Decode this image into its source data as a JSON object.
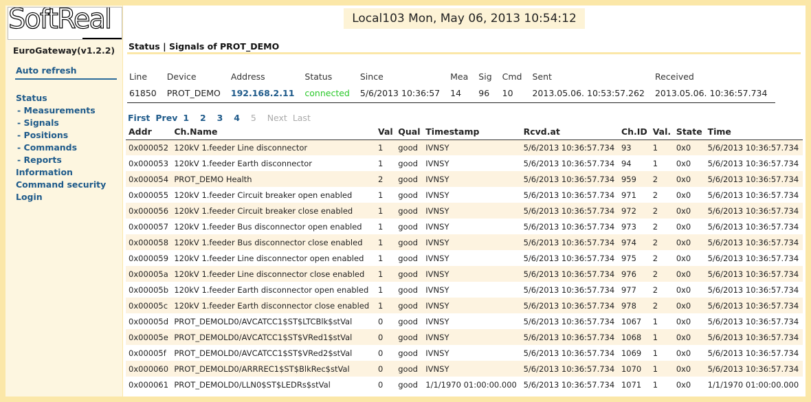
{
  "logo": {
    "text": "SoftReal"
  },
  "app_version": "EuroGateway(v1.2.2)",
  "sidebar": {
    "auto_refresh": "Auto refresh",
    "status": "Status",
    "measurements": "- Measurements",
    "signals": "- Signals",
    "positions": "- Positions",
    "commands": "- Commands",
    "reports": "- Reports",
    "information": "Information",
    "command_security": "Command security",
    "login": "Login"
  },
  "header": {
    "clock": "Local103 Mon, May 06, 2013 10:54:12"
  },
  "page_heading": "Status | Signals of PROT_DEMO",
  "line_table": {
    "headers": [
      "Line",
      "Device",
      "Address",
      "Status",
      "Since",
      "Mea",
      "Sig",
      "Cmd",
      "Sent",
      "Received"
    ],
    "row": {
      "line": "61850",
      "device": "PROT_DEMO",
      "address": "192.168.2.11",
      "status": "connected",
      "since": "5/6/2013 10:36:57",
      "mea": "14",
      "sig": "96",
      "cmd": "10",
      "sent": "2013.05.06. 10:53:57.262",
      "received": "2013.05.06. 10:36:57.734"
    }
  },
  "pager": {
    "first": "First",
    "prev": "Prev",
    "pages": [
      "1",
      "2",
      "3",
      "4",
      "5"
    ],
    "current_page": "4",
    "next": "Next",
    "last": "Last"
  },
  "signals_table": {
    "headers": [
      "Addr",
      "Ch.Name",
      "Val",
      "Qual",
      "Timestamp",
      "Rcvd.at",
      "Ch.ID",
      "Val.",
      "State",
      "Time"
    ],
    "rows": [
      [
        "0x000052",
        "120kV 1.feeder Line disconnector",
        "1",
        "good",
        "IVNSY",
        "5/6/2013 10:36:57.734",
        "93",
        "1",
        "0x0",
        "5/6/2013 10:36:57.734"
      ],
      [
        "0x000053",
        "120kV 1.feeder Earth disconnector",
        "1",
        "good",
        "IVNSY",
        "5/6/2013 10:36:57.734",
        "94",
        "1",
        "0x0",
        "5/6/2013 10:36:57.734"
      ],
      [
        "0x000054",
        "PROT_DEMO Health",
        "2",
        "good",
        "IVNSY",
        "5/6/2013 10:36:57.734",
        "959",
        "2",
        "0x0",
        "5/6/2013 10:36:57.734"
      ],
      [
        "0x000055",
        "120kV 1.feeder Circuit breaker open enabled",
        "1",
        "good",
        "IVNSY",
        "5/6/2013 10:36:57.734",
        "971",
        "2",
        "0x0",
        "5/6/2013 10:36:57.734"
      ],
      [
        "0x000056",
        "120kV 1.feeder Circuit breaker close enabled",
        "1",
        "good",
        "IVNSY",
        "5/6/2013 10:36:57.734",
        "972",
        "2",
        "0x0",
        "5/6/2013 10:36:57.734"
      ],
      [
        "0x000057",
        "120kV 1.feeder Bus disconnector open enabled",
        "1",
        "good",
        "IVNSY",
        "5/6/2013 10:36:57.734",
        "973",
        "2",
        "0x0",
        "5/6/2013 10:36:57.734"
      ],
      [
        "0x000058",
        "120kV 1.feeder Bus disconnector close enabled",
        "1",
        "good",
        "IVNSY",
        "5/6/2013 10:36:57.734",
        "974",
        "2",
        "0x0",
        "5/6/2013 10:36:57.734"
      ],
      [
        "0x000059",
        "120kV 1.feeder Line disconnector open enabled",
        "1",
        "good",
        "IVNSY",
        "5/6/2013 10:36:57.734",
        "975",
        "2",
        "0x0",
        "5/6/2013 10:36:57.734"
      ],
      [
        "0x00005a",
        "120kV 1.feeder Line disconnector close enabled",
        "1",
        "good",
        "IVNSY",
        "5/6/2013 10:36:57.734",
        "976",
        "2",
        "0x0",
        "5/6/2013 10:36:57.734"
      ],
      [
        "0x00005b",
        "120kV 1.feeder Earth disconnector open enabled",
        "1",
        "good",
        "IVNSY",
        "5/6/2013 10:36:57.734",
        "977",
        "2",
        "0x0",
        "5/6/2013 10:36:57.734"
      ],
      [
        "0x00005c",
        "120kV 1.feeder Earth disconnector close enabled",
        "1",
        "good",
        "IVNSY",
        "5/6/2013 10:36:57.734",
        "978",
        "2",
        "0x0",
        "5/6/2013 10:36:57.734"
      ],
      [
        "0x00005d",
        "PROT_DEMOLD0/AVCATCC1$ST$LTCBlk$stVal",
        "0",
        "good",
        "IVNSY",
        "5/6/2013 10:36:57.734",
        "1067",
        "1",
        "0x0",
        "5/6/2013 10:36:57.734"
      ],
      [
        "0x00005e",
        "PROT_DEMOLD0/AVCATCC1$ST$VRed1$stVal",
        "0",
        "good",
        "IVNSY",
        "5/6/2013 10:36:57.734",
        "1068",
        "1",
        "0x0",
        "5/6/2013 10:36:57.734"
      ],
      [
        "0x00005f",
        "PROT_DEMOLD0/AVCATCC1$ST$VRed2$stVal",
        "0",
        "good",
        "IVNSY",
        "5/6/2013 10:36:57.734",
        "1069",
        "1",
        "0x0",
        "5/6/2013 10:36:57.734"
      ],
      [
        "0x000060",
        "PROT_DEMOLD0/ARRREC1$ST$BlkRec$stVal",
        "0",
        "good",
        "IVNSY",
        "5/6/2013 10:36:57.734",
        "1070",
        "1",
        "0x0",
        "5/6/2013 10:36:57.734"
      ],
      [
        "0x000061",
        "PROT_DEMOLD0/LLN0$ST$LEDRs$stVal",
        "0",
        "good",
        "1/1/1970 01:00:00.000",
        "5/6/2013 10:36:57.734",
        "1071",
        "1",
        "0x0",
        "1/1/1970 01:00:00.000"
      ]
    ]
  }
}
